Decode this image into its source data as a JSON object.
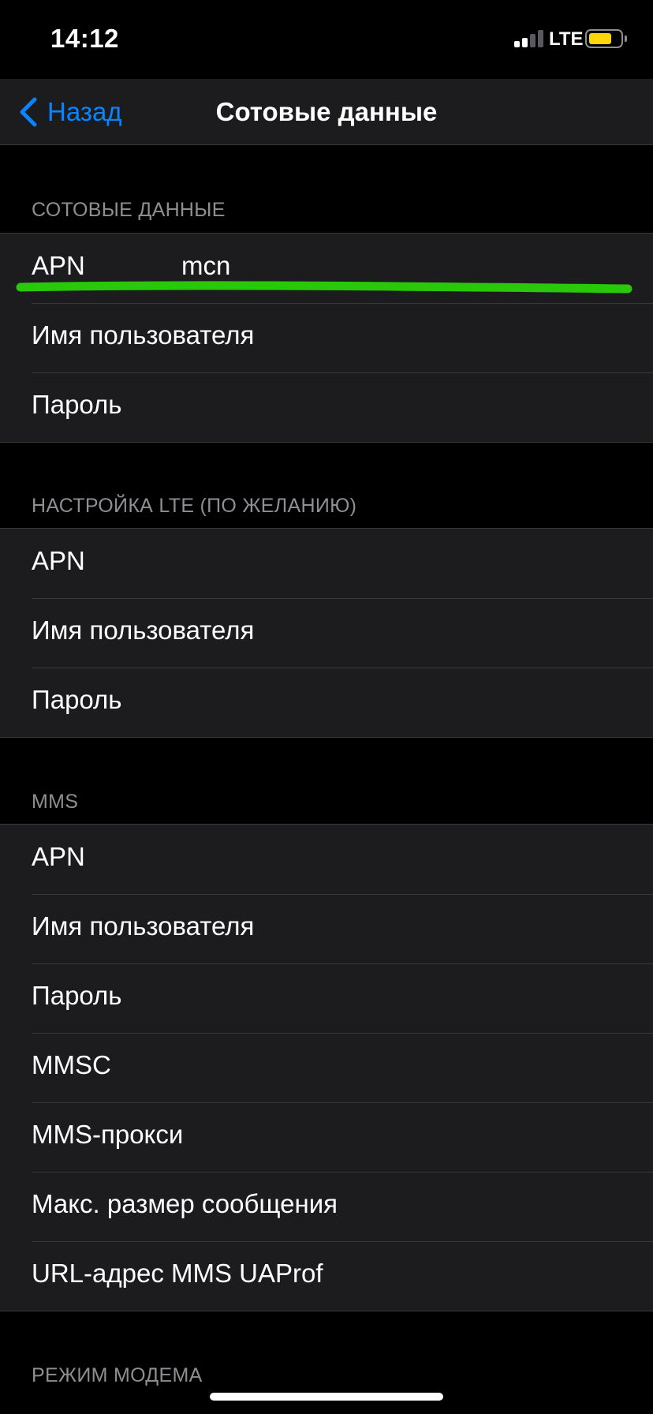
{
  "status_bar": {
    "time": "14:12",
    "network": "LTE",
    "battery_color": "#ffd60a"
  },
  "nav": {
    "back_label": "Назад",
    "title": "Сотовые данные",
    "accent_color": "#0a84ff"
  },
  "sections": [
    {
      "header": "СОТОВЫЕ ДАННЫЕ",
      "rows": [
        {
          "label": "APN",
          "value": "mcn"
        },
        {
          "label": "Имя пользователя",
          "value": ""
        },
        {
          "label": "Пароль",
          "value": ""
        }
      ]
    },
    {
      "header": "НАСТРОЙКА LTE (ПО ЖЕЛАНИЮ)",
      "rows": [
        {
          "label": "APN",
          "value": ""
        },
        {
          "label": "Имя пользователя",
          "value": ""
        },
        {
          "label": "Пароль",
          "value": ""
        }
      ]
    },
    {
      "header": "MMS",
      "rows": [
        {
          "label": "APN",
          "value": ""
        },
        {
          "label": "Имя пользователя",
          "value": ""
        },
        {
          "label": "Пароль",
          "value": ""
        },
        {
          "label": "MMSC",
          "value": ""
        },
        {
          "label": "MMS-прокси",
          "value": ""
        },
        {
          "label": "Макс. размер сообщения",
          "value": ""
        },
        {
          "label": "URL-адрес MMS UAProf",
          "value": ""
        }
      ]
    },
    {
      "header": "РЕЖИМ МОДЕМА",
      "rows": []
    }
  ],
  "annotation": {
    "stroke_color": "#2ac80a"
  }
}
